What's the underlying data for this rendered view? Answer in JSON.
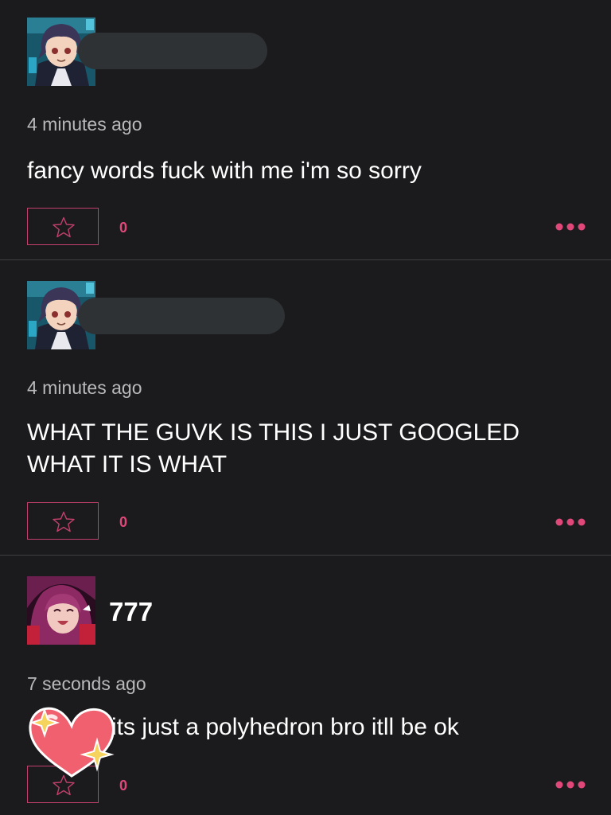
{
  "comments": [
    {
      "username": "",
      "timestamp": "4 minutes ago",
      "text": "fancy words fuck with me i'm so sorry",
      "star_count": "0"
    },
    {
      "username": "",
      "timestamp": "4 minutes ago",
      "text": "WHAT THE GUVK IS THIS I JUST GOOGLED WHAT IT IS WHAT",
      "star_count": "0"
    },
    {
      "username": "777",
      "timestamp": "7 seconds ago",
      "text": "its just a polyhedron bro itll be ok",
      "star_count": "0"
    }
  ],
  "icons": {
    "star": "star-outline-icon",
    "more": "more-dots-icon",
    "sticker": "heart-sparkle-sticker"
  },
  "colors": {
    "background": "#1b1b1d",
    "accent": "#e0487a",
    "divider": "#3f3f42",
    "muted_text": "#b9b9bb"
  }
}
